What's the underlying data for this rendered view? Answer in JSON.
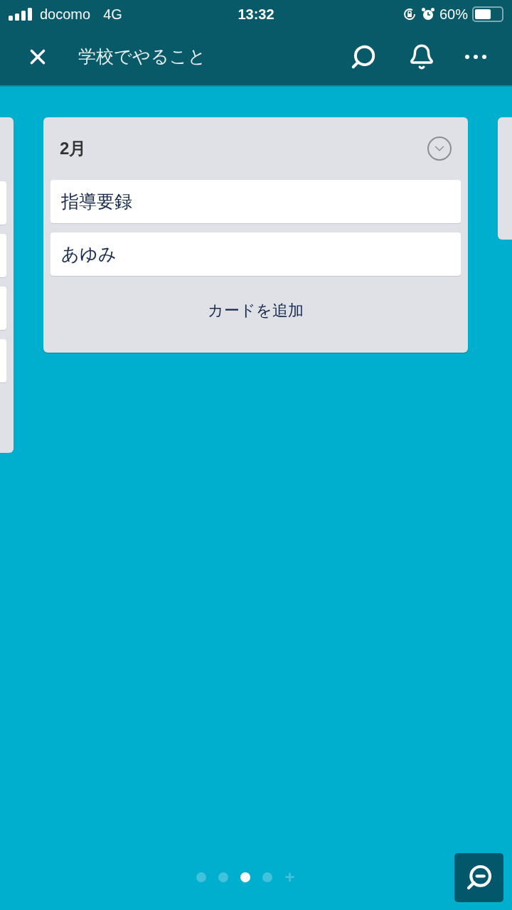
{
  "status_bar": {
    "carrier": "docomo",
    "network": "4G",
    "time": "13:32",
    "battery": "60%"
  },
  "header": {
    "title": "学校でやること"
  },
  "list": {
    "title": "2月",
    "expanded": false,
    "cards": [
      {
        "title": "指導要録"
      },
      {
        "title": "あゆみ"
      }
    ],
    "add_card": "カードを追加"
  },
  "page_dots": [
    {
      "kind": "dot",
      "selected": false
    },
    {
      "kind": "dot",
      "selected": false
    },
    {
      "kind": "dot",
      "selected": true
    },
    {
      "kind": "dot",
      "selected": false
    },
    {
      "kind": "add",
      "label": "+",
      "selected": false
    }
  ]
}
